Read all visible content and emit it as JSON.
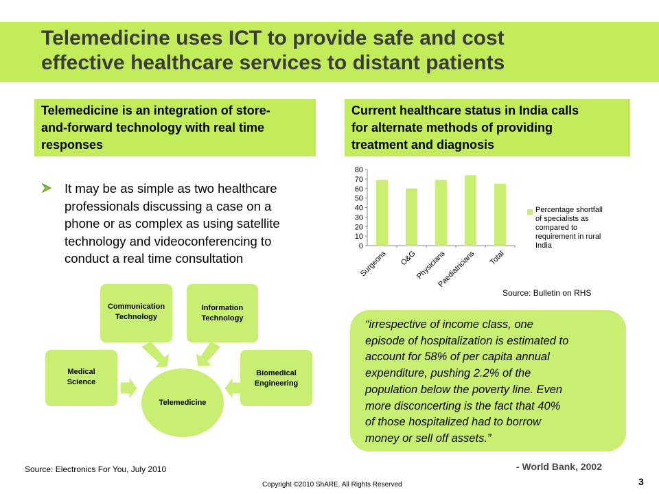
{
  "title": {
    "line1": "Telemedicine  uses ICT to provide safe and cost",
    "line2": "effective healthcare services to distant patients"
  },
  "left_box": {
    "line1": "Telemedicine is an integration of store-",
    "line2": "and-forward technology with real time",
    "line3": "responses"
  },
  "right_box": {
    "line1": "Current healthcare status in India calls",
    "line2": "for alternate methods of providing",
    "line3": "treatment and diagnosis"
  },
  "bullet": {
    "icon": "arrow-bullet-icon",
    "lines": [
      "It may be as simple as two healthcare",
      "professionals discussing a case on a",
      "phone or as complex as using satellite",
      "technology and videoconferencing to",
      "conduct a real time consultation"
    ]
  },
  "diagram": {
    "center": "Telemedicine",
    "nodes": {
      "communication": [
        "Communication",
        "Technology"
      ],
      "information": [
        "Information",
        "Technology"
      ],
      "medical": [
        "Medical",
        "Science"
      ],
      "biomedical": [
        "Biomedical",
        "Engineering"
      ]
    },
    "color": "#c8ee72"
  },
  "chart_data": {
    "type": "bar",
    "categories": [
      "Surgeons",
      "O&G",
      "Physicians",
      "Paediatricians",
      "Total"
    ],
    "values": [
      69,
      60,
      69,
      74,
      65
    ],
    "ylim": [
      0,
      80
    ],
    "yticks": [
      "0",
      "10",
      "20",
      "30",
      "40",
      "50",
      "60",
      "70",
      "80"
    ],
    "legend": [
      "Percentage shortfall",
      "of specialists as",
      "compared to",
      "requirement in rural",
      "India"
    ],
    "legend_position": "right",
    "grid": false,
    "bar_color": "#c8ee72"
  },
  "chart_source": "Source: Bulletin on RHS",
  "quote": {
    "lines": [
      "“irrespective of income class, one",
      "episode of hospitalization is estimated to",
      "account for 58% of per capita annual",
      "expenditure, pushing 2.2% of the",
      "population below the poverty line. Even",
      "more disconcerting is the fact that 40%",
      "of those hospitalized had to borrow",
      "money or sell off assets.”"
    ],
    "attribution": "- World Bank, 2002"
  },
  "source_left": "Source: Electronics For You, July 2010",
  "copyright": "Copyright ©2010 ShARE. All Rights Reserved",
  "page_number": "3",
  "colors": {
    "accent": "#c3ec5a",
    "title_text": "#3b3b3b"
  }
}
